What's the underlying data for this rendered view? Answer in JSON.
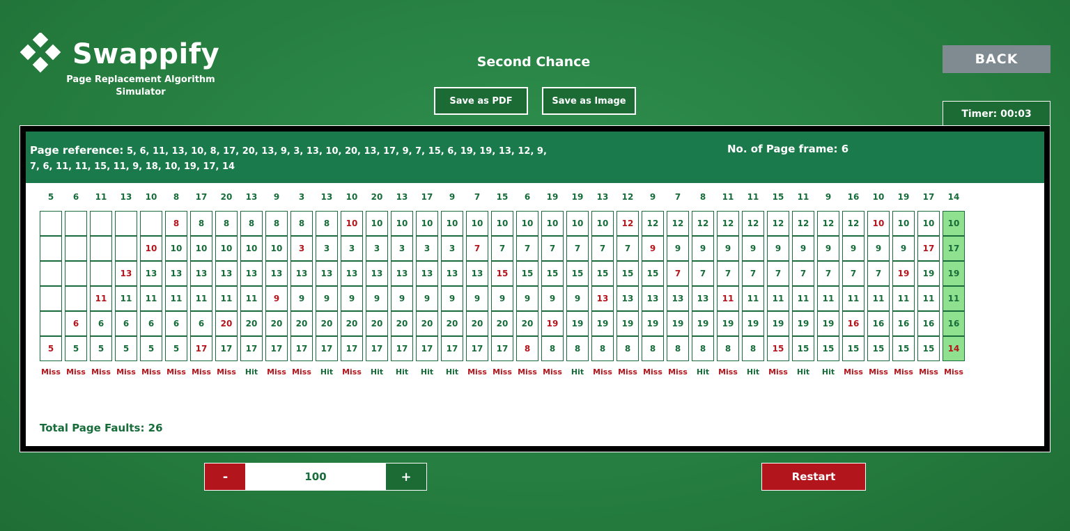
{
  "logo": {
    "title": "Swappify",
    "subtitle": "Page Replacement Algorithm Simulator"
  },
  "algorithm_title": "Second Chance",
  "toolbar": {
    "save_pdf": "Save as PDF",
    "save_image": "Save as Image",
    "back": "BACK"
  },
  "timer": "Timer: 00:03",
  "page_reference": {
    "label": "Page reference:",
    "values": "5, 6, 11, 13, 10, 8, 17, 20, 13, 9, 3, 13, 10, 20, 13, 17, 9, 7, 15, 6, 19, 19, 13, 12, 9, 7, 6, 11, 11, 15, 11, 9, 18, 10, 19, 17, 14"
  },
  "page_frames": "No. of Page frame: 6",
  "reference_string": [
    "5",
    "6",
    "11",
    "13",
    "10",
    "8",
    "17",
    "20",
    "13",
    "9",
    "3",
    "13",
    "10",
    "20",
    "13",
    "17",
    "9",
    "7",
    "15",
    "6",
    "19",
    "19",
    "13",
    "12",
    "9",
    "7",
    "8",
    "11",
    "11",
    "15",
    "11",
    "9",
    "16",
    "10",
    "19",
    "17",
    "14"
  ],
  "frames_table": [
    [
      "",
      "",
      "",
      "",
      "",
      "8",
      "8",
      "8",
      "8",
      "8",
      "8",
      "8",
      "10",
      "10",
      "10",
      "10",
      "10",
      "10",
      "10",
      "10",
      "10",
      "10",
      "10",
      "12",
      "12",
      "12",
      "12",
      "12",
      "12",
      "12",
      "12",
      "12",
      "12",
      "10",
      "10",
      "10",
      "10"
    ],
    [
      "",
      "",
      "",
      "",
      "10",
      "10",
      "10",
      "10",
      "10",
      "10",
      "3",
      "3",
      "3",
      "3",
      "3",
      "3",
      "3",
      "7",
      "7",
      "7",
      "7",
      "7",
      "7",
      "7",
      "9",
      "9",
      "9",
      "9",
      "9",
      "9",
      "9",
      "9",
      "9",
      "9",
      "9",
      "17",
      "17"
    ],
    [
      "",
      "",
      "",
      "13",
      "13",
      "13",
      "13",
      "13",
      "13",
      "13",
      "13",
      "13",
      "13",
      "13",
      "13",
      "13",
      "13",
      "13",
      "15",
      "15",
      "15",
      "15",
      "15",
      "15",
      "15",
      "7",
      "7",
      "7",
      "7",
      "7",
      "7",
      "7",
      "7",
      "7",
      "19",
      "19",
      "19"
    ],
    [
      "",
      "",
      "11",
      "11",
      "11",
      "11",
      "11",
      "11",
      "11",
      "9",
      "9",
      "9",
      "9",
      "9",
      "9",
      "9",
      "9",
      "9",
      "9",
      "9",
      "9",
      "9",
      "13",
      "13",
      "13",
      "13",
      "13",
      "11",
      "11",
      "11",
      "11",
      "11",
      "11",
      "11",
      "11",
      "11",
      "11"
    ],
    [
      "",
      "6",
      "6",
      "6",
      "6",
      "6",
      "6",
      "20",
      "20",
      "20",
      "20",
      "20",
      "20",
      "20",
      "20",
      "20",
      "20",
      "20",
      "20",
      "20",
      "19",
      "19",
      "19",
      "19",
      "19",
      "19",
      "19",
      "19",
      "19",
      "19",
      "19",
      "19",
      "16",
      "16",
      "16",
      "16",
      "16"
    ],
    [
      "5",
      "5",
      "5",
      "5",
      "5",
      "5",
      "17",
      "17",
      "17",
      "17",
      "17",
      "17",
      "17",
      "17",
      "17",
      "17",
      "17",
      "17",
      "17",
      "8",
      "8",
      "8",
      "8",
      "8",
      "8",
      "8",
      "8",
      "8",
      "8",
      "15",
      "15",
      "15",
      "15",
      "15",
      "15",
      "15",
      "14"
    ]
  ],
  "highlighted_cells": [
    [
      0,
      5
    ],
    [
      0,
      12
    ],
    [
      0,
      23
    ],
    [
      0,
      33
    ],
    [
      1,
      4
    ],
    [
      1,
      10
    ],
    [
      1,
      17
    ],
    [
      1,
      24
    ],
    [
      1,
      35
    ],
    [
      2,
      3
    ],
    [
      2,
      18
    ],
    [
      2,
      25
    ],
    [
      2,
      34
    ],
    [
      3,
      2
    ],
    [
      3,
      9
    ],
    [
      3,
      22
    ],
    [
      3,
      27
    ],
    [
      4,
      1
    ],
    [
      4,
      7
    ],
    [
      4,
      20
    ],
    [
      4,
      32
    ],
    [
      5,
      0
    ],
    [
      5,
      6
    ],
    [
      5,
      19
    ],
    [
      5,
      29
    ],
    [
      5,
      36
    ]
  ],
  "statuses": [
    "Miss",
    "Miss",
    "Miss",
    "Miss",
    "Miss",
    "Miss",
    "Miss",
    "Miss",
    "Hit",
    "Miss",
    "Miss",
    "Hit",
    "Miss",
    "Hit",
    "Hit",
    "Hit",
    "Hit",
    "Miss",
    "Miss",
    "Miss",
    "Miss",
    "Hit",
    "Miss",
    "Miss",
    "Miss",
    "Miss",
    "Hit",
    "Miss",
    "Hit",
    "Miss",
    "Hit",
    "Hit",
    "Miss",
    "Miss",
    "Miss",
    "Miss",
    "Miss"
  ],
  "total_faults": "Total Page Faults: 26",
  "speed": {
    "minus": "-",
    "value": "100",
    "plus": "+"
  },
  "restart": "Restart",
  "colors": {
    "miss": "#b3151d",
    "hit": "#176c3a",
    "last_column": "#8fe08f"
  }
}
